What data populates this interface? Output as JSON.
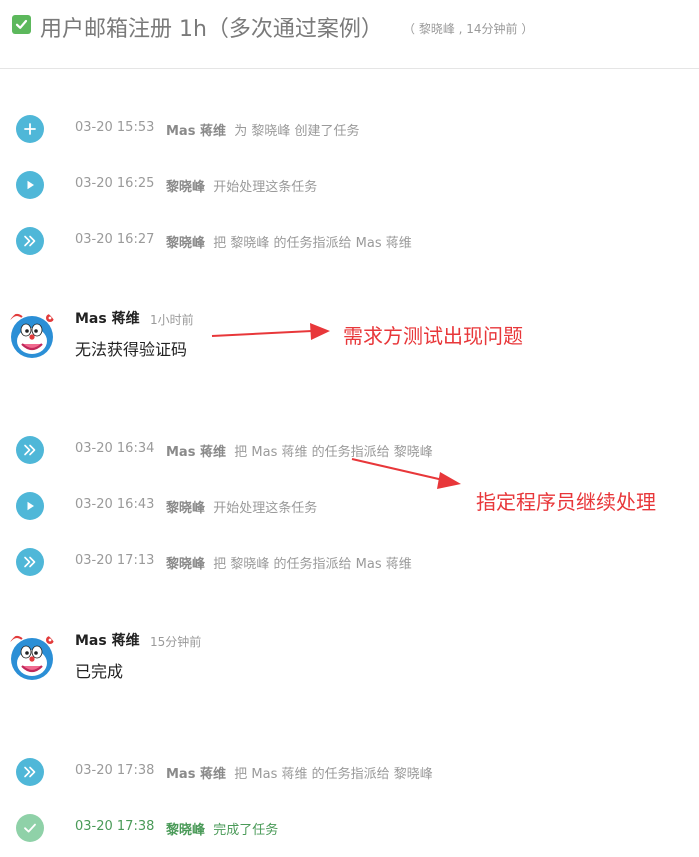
{
  "header": {
    "title": "用户邮箱注册 1h（多次通过案例）",
    "meta": "（ 黎晓峰 , 14分钟前 ）"
  },
  "events_1": [
    {
      "icon": "plus-icon",
      "time": "03-20 15:53",
      "actor": "Mas 蒋维",
      "text": "为 黎晓峰 创建了任务"
    },
    {
      "icon": "play-icon",
      "time": "03-20 16:25",
      "actor": "黎晓峰",
      "text": "开始处理这条任务"
    },
    {
      "icon": "double-chevron-icon",
      "time": "03-20 16:27",
      "actor": "黎晓峰",
      "text": "把 黎晓峰 的任务指派给 Mas 蒋维"
    }
  ],
  "comment_1": {
    "author": "Mas 蒋维",
    "when": "1小时前",
    "body": "无法获得验证码"
  },
  "events_2": [
    {
      "icon": "double-chevron-icon",
      "time": "03-20 16:34",
      "actor": "Mas 蒋维",
      "text": "把 Mas 蒋维 的任务指派给 黎晓峰"
    },
    {
      "icon": "play-icon",
      "time": "03-20 16:43",
      "actor": "黎晓峰",
      "text": "开始处理这条任务"
    },
    {
      "icon": "double-chevron-icon",
      "time": "03-20 17:13",
      "actor": "黎晓峰",
      "text": "把 黎晓峰 的任务指派给 Mas 蒋维"
    }
  ],
  "comment_2": {
    "author": "Mas 蒋维",
    "when": "15分钟前",
    "body": "已完成"
  },
  "events_3": [
    {
      "icon": "double-chevron-icon",
      "time": "03-20 17:38",
      "actor": "Mas 蒋维",
      "text": "把 Mas 蒋维 的任务指派给 黎晓峰"
    },
    {
      "icon": "check-circle-icon",
      "time": "03-20 17:38",
      "actor": "黎晓峰",
      "text": "完成了任务",
      "status": "done"
    }
  ],
  "annotations": {
    "note_1": "需求方测试出现问题",
    "note_2": "指定程序员继续处理"
  },
  "colors": {
    "icon_blue": "#4fb7d8",
    "icon_done_green": "#8fd1a8",
    "done_text_green": "#4a9a58",
    "annotation_red": "#e8373a",
    "header_check_green": "#5cb85c"
  }
}
